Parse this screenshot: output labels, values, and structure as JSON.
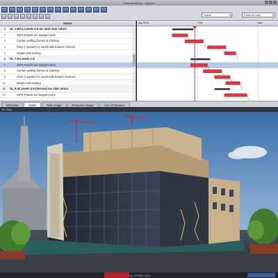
{
  "window": {
    "title": "Clarence 5G.sp - Synchro"
  },
  "toolbar": {
    "install_field": "Install",
    "finish_field": "Finish to start"
  },
  "tasks": {
    "column_header": "Name",
    "rows": [
      {
        "num": "1",
        "label": "GL 1 B/C1 Levels 4-6 Inc stair riser return",
        "type": "summary"
      },
      {
        "num": "2",
        "label": "SIPS Panels inc Support work",
        "type": "sub"
      },
      {
        "num": "3",
        "label": "Curtain walling frames & Glazing",
        "type": "sub"
      },
      {
        "num": "4",
        "label": "Fibre C panels inc canal-rails feature channel",
        "type": "sub"
      },
      {
        "num": "5",
        "label": "Mastic and sealing",
        "type": "sub"
      },
      {
        "num": "6",
        "label": "GL 7 M Levels 1-4",
        "type": "summary"
      },
      {
        "num": "7",
        "label": "SIPS Panels inc Support work",
        "type": "selected"
      },
      {
        "num": "8",
        "label": "Curtain walling frames & Glazing",
        "type": "sub"
      },
      {
        "num": "9",
        "label": "Fibre C panels inc canal rails feature channel",
        "type": "sub"
      },
      {
        "num": "10",
        "label": "Mastic and sealing",
        "type": "sub"
      },
      {
        "num": "11",
        "label": "GL R M Levels 4-6 (terrace) inc stair return",
        "type": "summary"
      },
      {
        "num": "12",
        "label": "SIPS Panels inc Support work",
        "type": "sub"
      }
    ]
  },
  "gantt": {
    "months": [
      "Jan 2011",
      "Feb",
      "Mar"
    ],
    "bars": [
      {
        "row": 1,
        "start": 0.25,
        "end": 0.4,
        "kind": "summary"
      },
      {
        "row": 2,
        "start": 0.25,
        "end": 0.36,
        "kind": "task"
      },
      {
        "row": 3,
        "start": 0.34,
        "end": 0.47,
        "kind": "task"
      },
      {
        "row": 4,
        "start": 0.5,
        "end": 0.63,
        "kind": "task"
      },
      {
        "row": 5,
        "start": 0.62,
        "end": 0.7,
        "kind": "task"
      },
      {
        "row": 6,
        "start": 0.38,
        "end": 0.52,
        "kind": "summary"
      },
      {
        "row": 7,
        "start": 0.38,
        "end": 0.5,
        "kind": "task"
      },
      {
        "row": 8,
        "start": 0.47,
        "end": 0.6,
        "kind": "task"
      },
      {
        "row": 9,
        "start": 0.55,
        "end": 0.66,
        "kind": "task"
      },
      {
        "row": 10,
        "start": 0.63,
        "end": 0.73,
        "kind": "task"
      },
      {
        "row": 11,
        "start": 0.55,
        "end": 0.66,
        "kind": "summary"
      },
      {
        "row": 12,
        "start": 0.62,
        "end": 0.78,
        "kind": "task"
      }
    ],
    "today_fraction": 0.41
  },
  "tabs": [
    "Welcome",
    "Gantt",
    "Task Usage",
    "Resource Usage",
    "Line Of Balance"
  ],
  "active_tab": "Gantt",
  "viewport": {
    "title": "3D View"
  },
  "status": {
    "center": "Sun, 27 Feb, 2011"
  },
  "colors": {
    "task_bar": "#e0383f",
    "summary_bar": "#2a2a2a",
    "today_line": "#e02020",
    "selection": "#b9c7e6"
  }
}
